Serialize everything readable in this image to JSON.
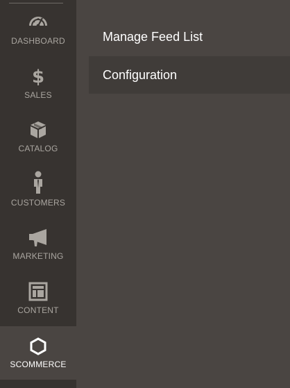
{
  "sidebar": {
    "items": [
      {
        "label": "DASHBOARD",
        "icon": "dashboard-gauge-icon"
      },
      {
        "label": "SALES",
        "icon": "dollar-icon"
      },
      {
        "label": "CATALOG",
        "icon": "cube-box-icon"
      },
      {
        "label": "CUSTOMERS",
        "icon": "person-icon"
      },
      {
        "label": "MARKETING",
        "icon": "megaphone-icon"
      },
      {
        "label": "CONTENT",
        "icon": "layout-icon"
      },
      {
        "label": "SCOMMERCE",
        "icon": "hexagon-icon",
        "active": true
      }
    ]
  },
  "submenu": {
    "items": [
      {
        "label": "Manage Feed List"
      },
      {
        "label": "Configuration"
      }
    ]
  },
  "colors": {
    "sidebar_bg": "#373330",
    "submenu_bg": "#4a4542",
    "item_text": "#aaa6a0",
    "active_text": "#ffffff"
  }
}
